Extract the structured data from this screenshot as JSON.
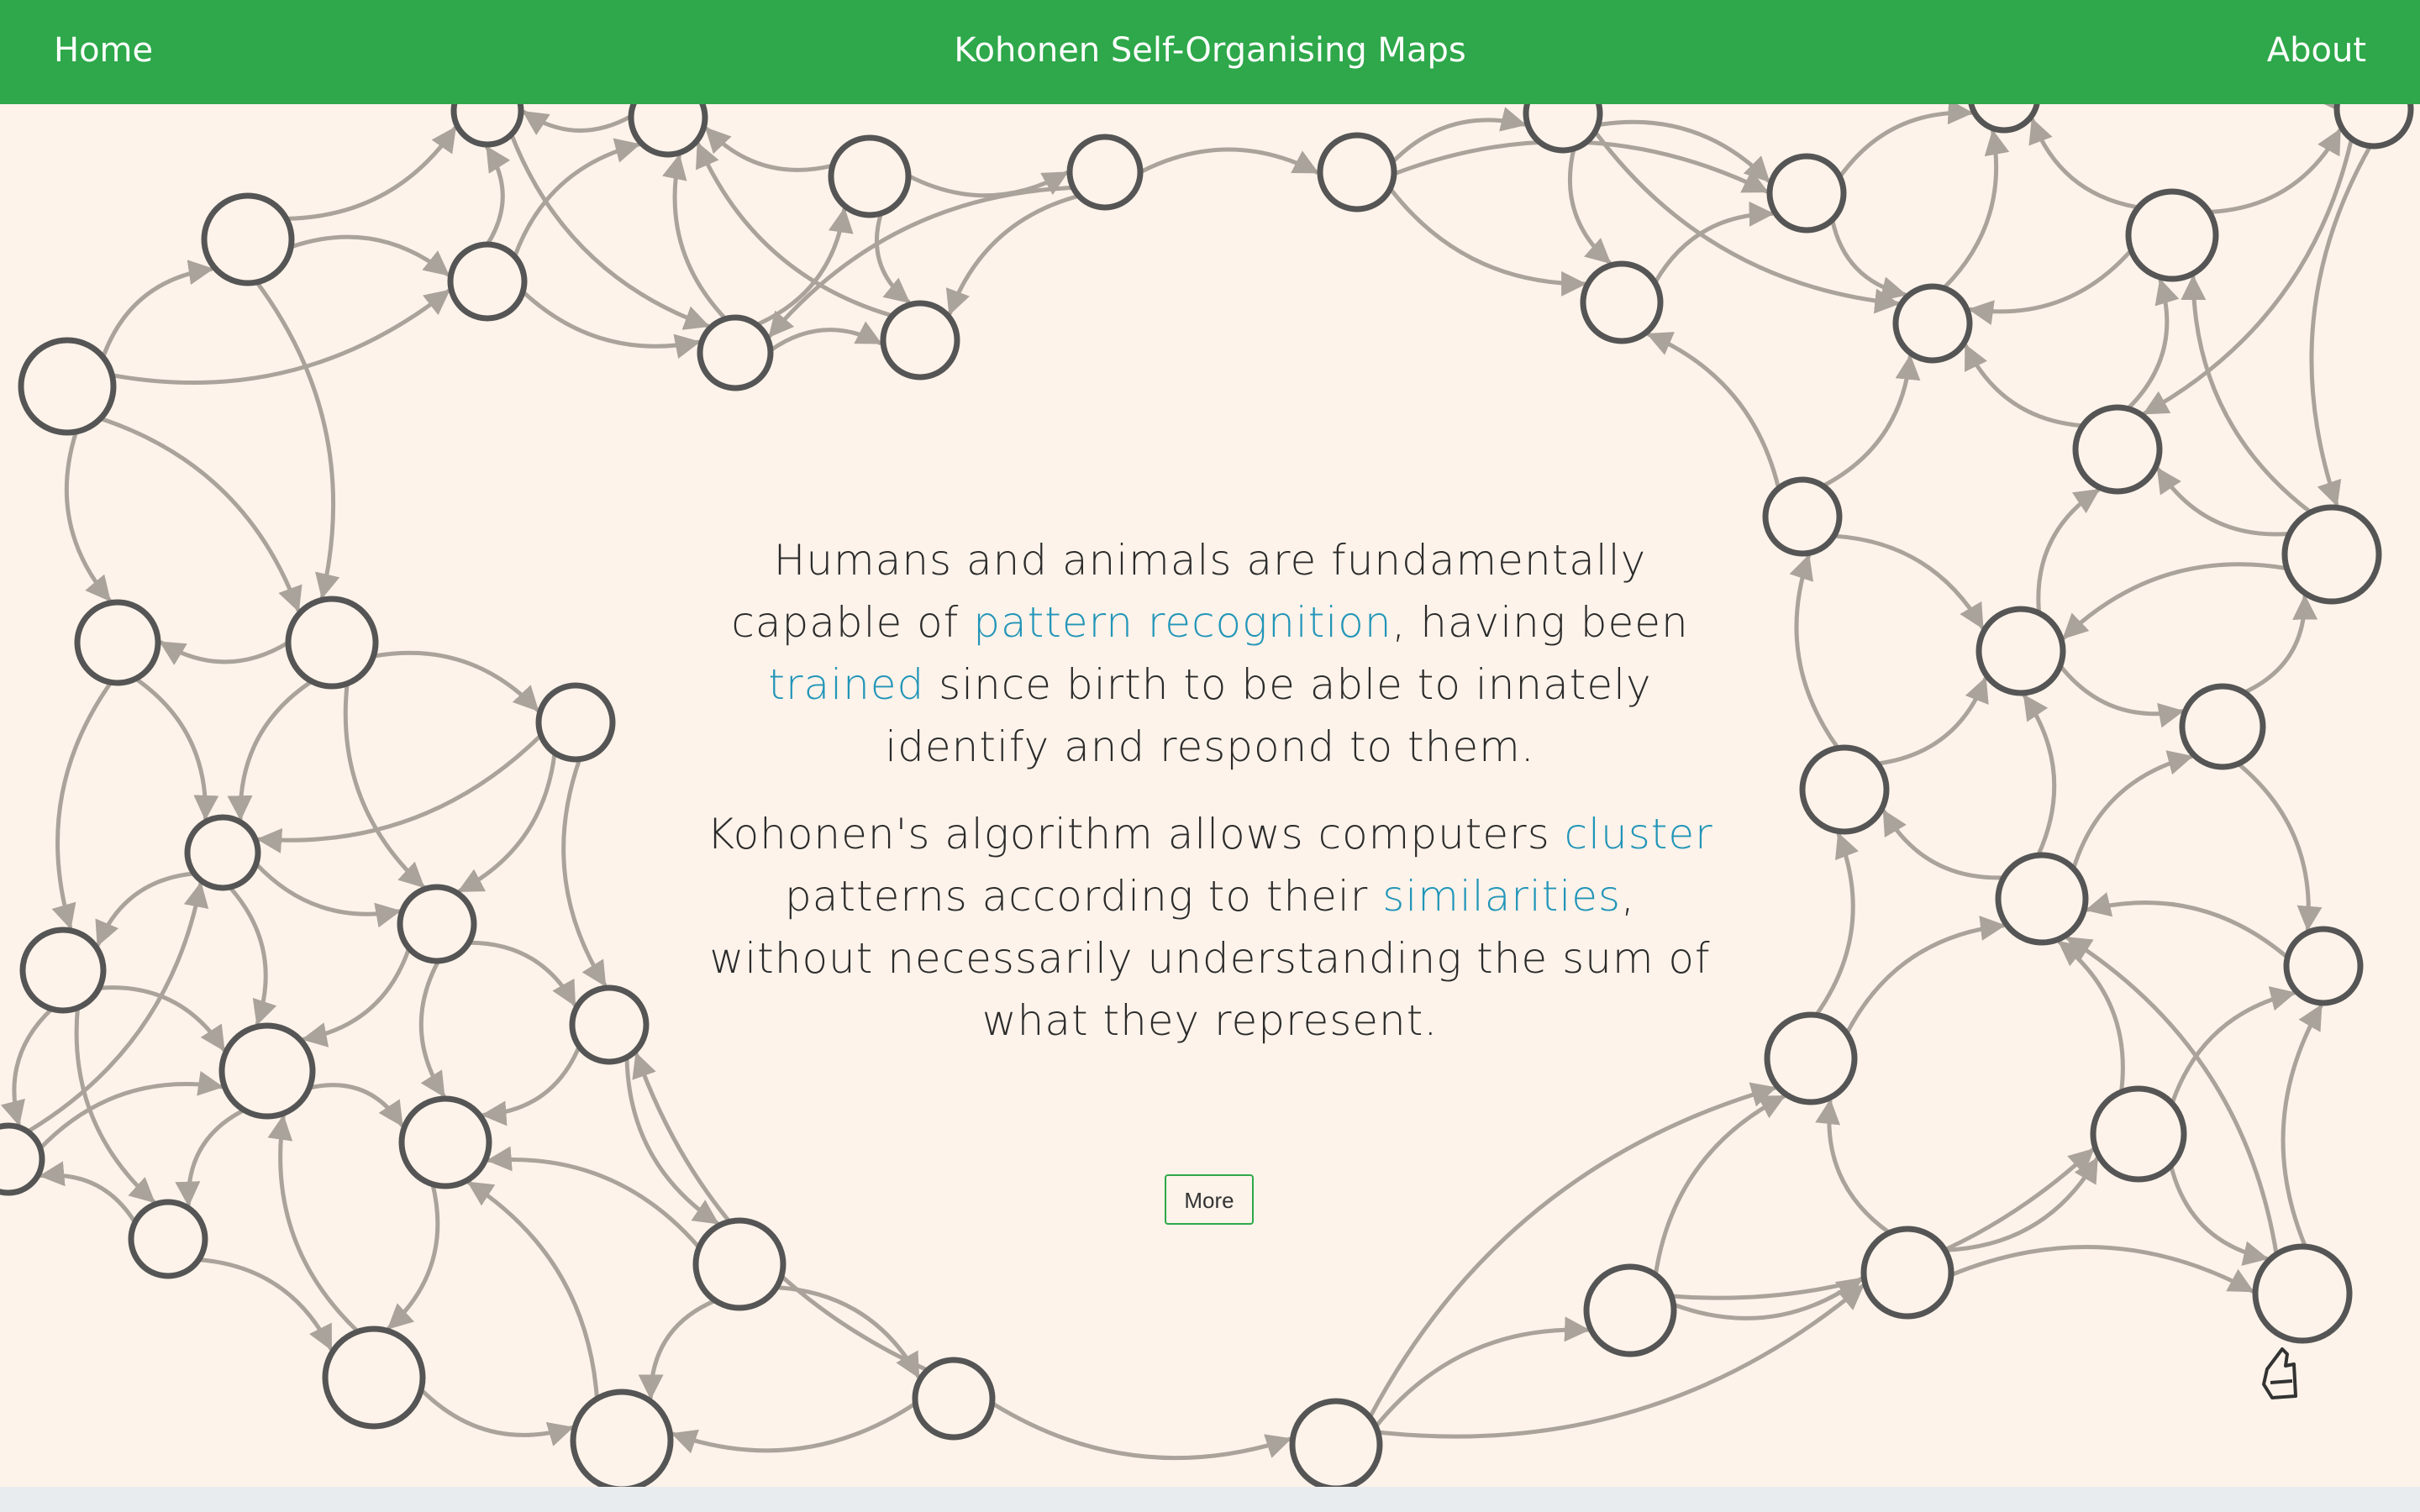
{
  "header": {
    "home_label": "Home",
    "title": "Kohonen Self-Organising Maps",
    "about_label": "About"
  },
  "intro": {
    "paragraph1": {
      "part1": "Humans and animals are fundamentally capable of ",
      "link1": "pattern recognition",
      "part2": ", having been ",
      "link2": "trained",
      "part3": " since birth to be able to innately identify and respond to them."
    },
    "paragraph2": {
      "part1": "Kohonen's algorithm allows computers ",
      "link1": "cluster",
      "part2": " patterns according to their ",
      "link2": "similarities",
      "part3": ", without necessarily understanding the sum of what they represent."
    }
  },
  "more_button": {
    "label": "More"
  },
  "colors": {
    "header_bg": "#2ea84a",
    "page_bg": "#fdf3ea",
    "highlight": "#2195b8",
    "node_stroke": "#555555",
    "edge_stroke": "#aaa39b"
  }
}
